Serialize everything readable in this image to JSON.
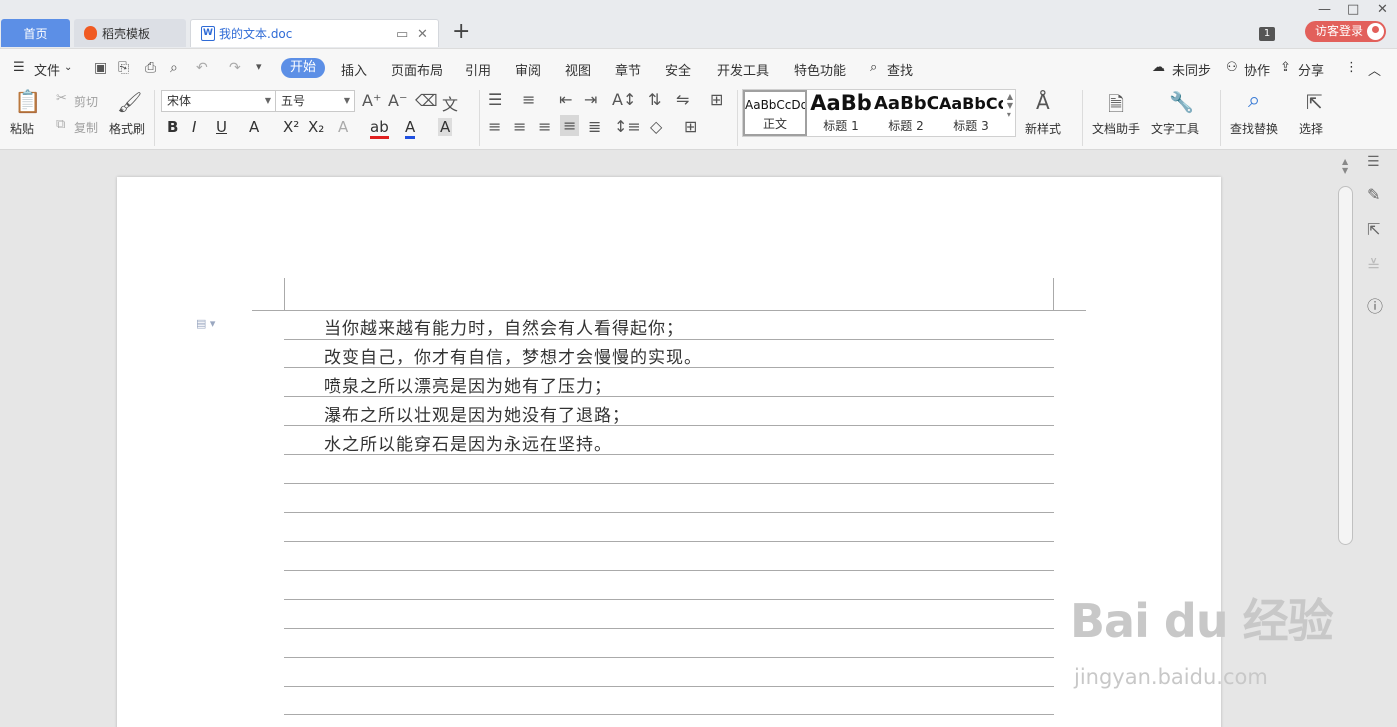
{
  "tabs": {
    "home": "首页",
    "daoke": "稻壳模板",
    "doc": "我的文本.doc",
    "add": "+"
  },
  "window": {
    "minimize": "—",
    "maximize": "□",
    "close": "✕",
    "badge": "1"
  },
  "login": "访客登录",
  "menu": {
    "file": "文件",
    "start": "开始",
    "insert": "插入",
    "layout": "页面布局",
    "reference": "引用",
    "review": "审阅",
    "view": "视图",
    "chapter": "章节",
    "security": "安全",
    "devtools": "开发工具",
    "special": "特色功能",
    "find": "查找",
    "sync": "未同步",
    "collab": "协作",
    "share": "分享"
  },
  "ribbon": {
    "paste": "粘贴",
    "cut": "剪切",
    "copy": "复制",
    "format_painter": "格式刷",
    "font": "宋体",
    "size": "五号",
    "styles": [
      {
        "preview": "AaBbCcDd",
        "name": "正文"
      },
      {
        "preview": "AaBb",
        "name": "标题 1"
      },
      {
        "preview": "AaBbC",
        "name": "标题 2"
      },
      {
        "preview": "AaBbCc",
        "name": "标题 3"
      }
    ],
    "new_style": "新样式",
    "doc_assistant": "文档助手",
    "text_tools": "文字工具",
    "find_replace": "查找替换",
    "select": "选择"
  },
  "document": {
    "lines": [
      "当你越来越有能力时，自然会有人看得起你；",
      "改变自己，你才有自信，梦想才会慢慢的实现。",
      "喷泉之所以漂亮是因为她有了压力；",
      "瀑布之所以壮观是因为她没有了退路；",
      "水之所以能穿石是因为永远在坚持。"
    ]
  },
  "watermark": {
    "main": "Bai du 经验",
    "sub": "jingyan.baidu.com"
  }
}
